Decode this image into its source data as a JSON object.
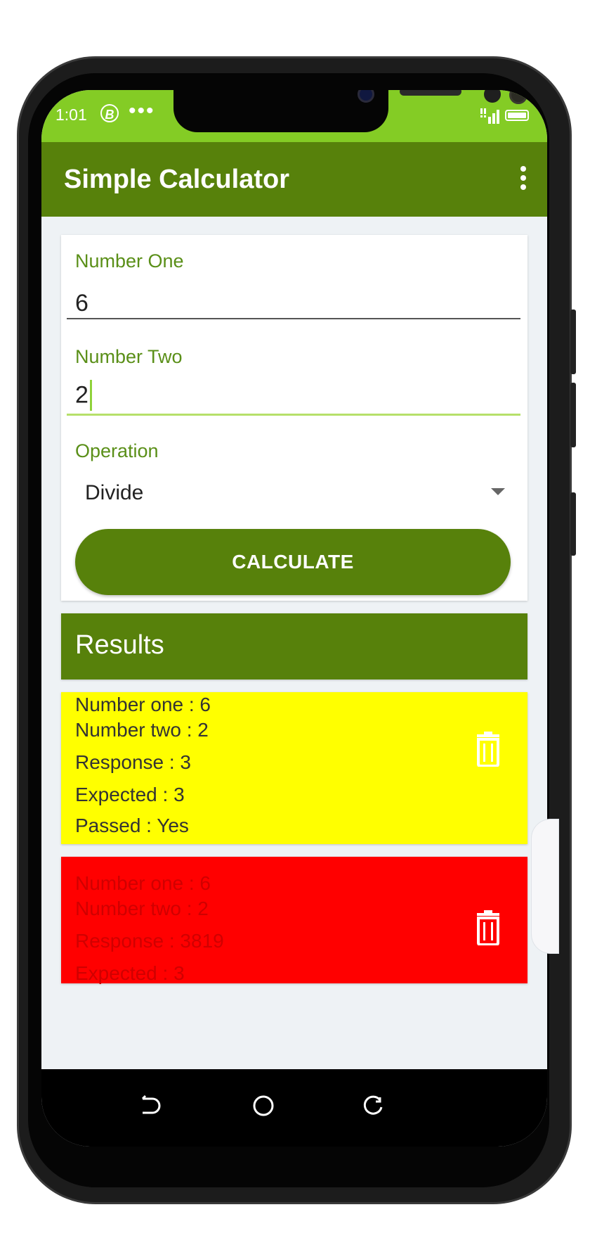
{
  "status_bar": {
    "time": "1:01",
    "app_badge": "B",
    "more_dots": "•••"
  },
  "app_bar": {
    "title": "Simple Calculator"
  },
  "form": {
    "number_one_label": "Number One",
    "number_one_value": "6",
    "number_two_label": "Number Two",
    "number_two_value": "2",
    "operation_label": "Operation",
    "operation_value": "Divide",
    "calculate_label": "CALCULATE"
  },
  "results": {
    "title": "Results",
    "items": [
      {
        "number_one": "Number one : 6",
        "number_two": "Number two : 2",
        "response": "Response : 3",
        "expected": "Expected : 3",
        "passed": "Passed : Yes",
        "bg_color": "#ffff00",
        "text_color": "#333333"
      },
      {
        "number_one": "Number one : 6",
        "number_two": "Number two : 2",
        "response": "Response : 3819",
        "expected": "Expected : 3",
        "bg_color": "#ff0000",
        "text_color": "#d00000"
      }
    ]
  },
  "colors": {
    "status_bar": "#84cc25",
    "primary": "#57810b",
    "label": "#5a8f18",
    "focus_line": "#b6e06a"
  }
}
